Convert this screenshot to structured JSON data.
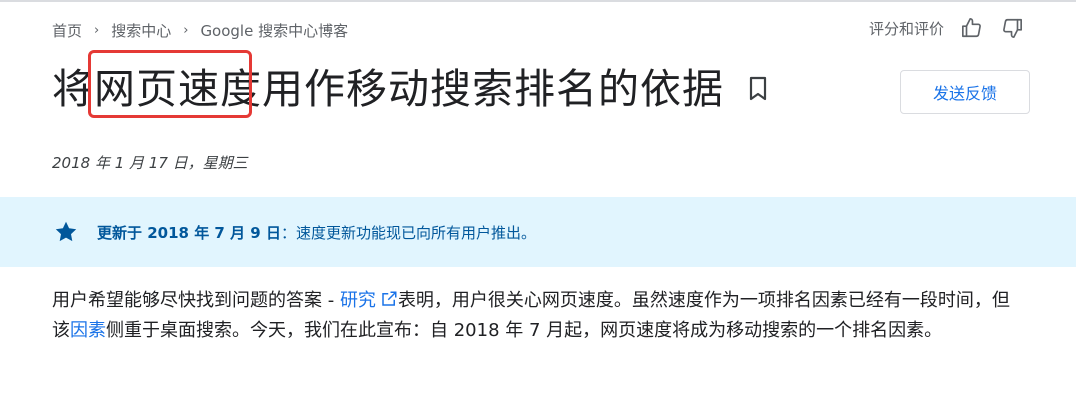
{
  "breadcrumb": {
    "items": [
      "首页",
      "搜索中心",
      "Google 搜索中心博客"
    ],
    "separator": "›"
  },
  "rating": {
    "label": "评分和评价"
  },
  "title": "将网页速度用作移动搜索排名的依据",
  "feedback_button": "发送反馈",
  "date": "2018 年 1 月 17 日，星期三",
  "banner": {
    "bold": "更新于 2018 年 7 月 9 日",
    "text": "：速度更新功能现已向所有用户推出。"
  },
  "paragraph": {
    "part1": "用户希望能够尽快找到问题的答案 - ",
    "link1": "研究",
    "part2": "表明，用户很关心网页速度。虽然速度作为一项排名因素已经有一段时间，但该",
    "link2": "因素",
    "part3": "侧重于桌面搜索。今天，我们在此宣布：自 2018 年 7 月起，网页速度将成为移动搜索的一个排名因素。"
  },
  "colors": {
    "accent": "#1a73e8",
    "banner_bg": "#e1f5fe",
    "banner_text": "#01579b",
    "highlight": "#e53935"
  }
}
